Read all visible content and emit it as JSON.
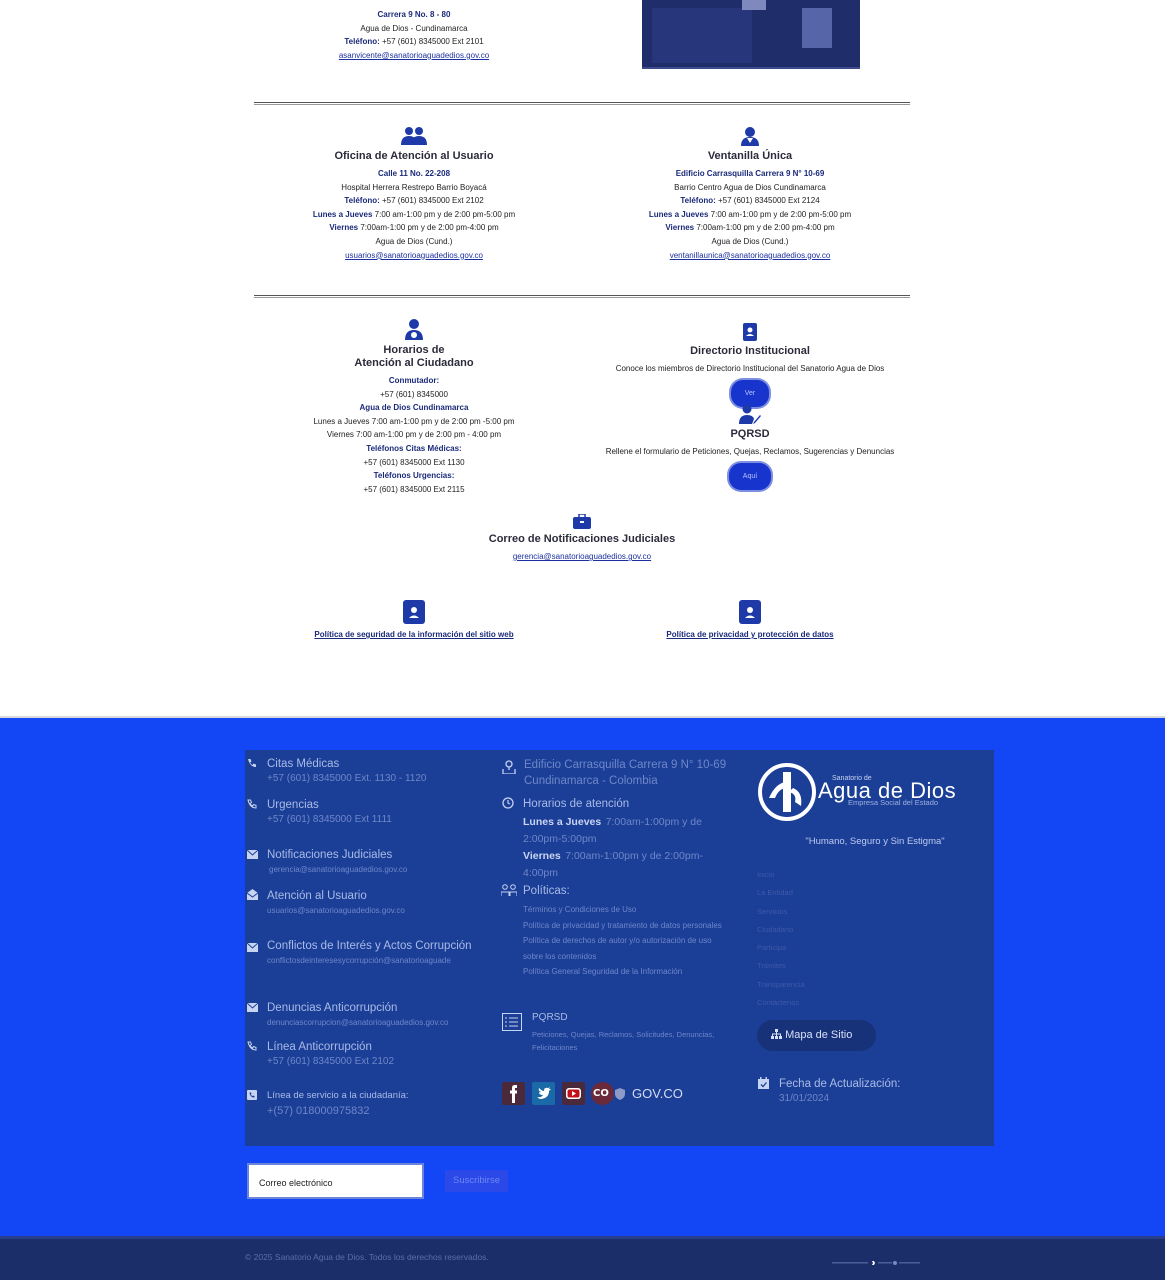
{
  "top": {
    "address_block": {
      "line1": "Carrera 9 No. 8 - 80",
      "line2": "Agua de Dios - Cundinamarca",
      "phone_label": "Teléfono:",
      "phone": "+57 (601) 8345000 Ext 2101",
      "email": "asanvicente@sanatorioaguadedios.gov.co"
    },
    "oficina": {
      "title": "Oficina de Atención al Usuario",
      "l1": "Calle 11 No. 22-208",
      "l2": "Hospital Herrera Restrepo Barrio Boyacá",
      "phone_label": "Teléfono:",
      "phone": "+57 (601) 8345000 Ext 2102",
      "h1_label": "Lunes a Jueves",
      "h1": "7:00 am-1:00 pm y de 2:00 pm-5:00 pm",
      "h2_label": "Viernes",
      "h2": "7:00am-1:00 pm y de 2:00 pm-4:00 pm",
      "city": "Agua de Dios (Cund.)",
      "email": "usuarios@sanatorioaguadedios.gov.co"
    },
    "ventanilla": {
      "title": "Ventanilla Única",
      "l1": "Edificio Carrasquilla Carrera 9 N° 10-69",
      "l2": "Barrio Centro Agua de Dios Cundinamarca",
      "phone_label": "Teléfono:",
      "phone": "+57 (601) 8345000 Ext 2124",
      "h1_label": "Lunes a Jueves",
      "h1": "7:00 am-1:00 pm y de 2:00 pm-5:00 pm",
      "h2_label": "Viernes",
      "h2": "7:00am-1:00 pm y de 2:00 pm-4:00 pm",
      "city": "Agua de Dios (Cund.)",
      "email": "ventanillaunica@sanatorioaguadedios.gov.co"
    },
    "horarios": {
      "title1": "Horarios de",
      "title2": "Atención al Ciudadano",
      "conm_label": "Conmutador:",
      "conm": "+57 (601) 8345000",
      "city": "Agua de Dios Cundinamarca",
      "h1": "Lunes a Jueves 7:00 am-1:00 pm y de 2:00 pm -5:00 pm",
      "h2": "Viernes 7:00 am-1:00 pm y de 2:00 pm - 4:00 pm",
      "citas_label": "Teléfonos Citas Médicas:",
      "citas": "+57 (601) 8345000 Ext 1130",
      "urg_label": "Teléfonos Urgencias:",
      "urg": "+57 (601) 8345000 Ext 2115"
    },
    "directorio": {
      "title": "Directorio Institucional",
      "desc": "Conoce los miembros de Directorio Institucional del Sanatorio Agua de Dios",
      "btn": "Ver"
    },
    "pqrsd": {
      "title": "PQRSD",
      "desc": "Rellene el formulario de Peticiones, Quejas, Reclamos, Sugerencias y Denuncias",
      "btn": "Aquí"
    },
    "notificaciones": {
      "title": "Correo de Notificaciones Judiciales",
      "email": "gerencia@sanatorioaguadedios.gov.co"
    },
    "politica1": "Política de seguridad de la información del sitio web",
    "politica2": "Política de privacidad y protección de datos"
  },
  "footer": {
    "col1": [
      {
        "title": "Citas Médicas",
        "value": "+57 (601) 8345000 Ext. 1130 - 1120"
      },
      {
        "title": "Urgencias",
        "value": "+57 (601) 8345000 Ext 1111"
      },
      {
        "title": "Notificaciones Judiciales",
        "value": "gerencia@sanatorioaguadedios.gov.co"
      },
      {
        "title": "Atención al Usuario",
        "value": "usuarios@sanatorioaguadedios.gov.co"
      },
      {
        "title": "Conflictos de Interés y Actos Corrupción",
        "value": "conflictosdeinteresesycorrupción@sanatorioaguade"
      },
      {
        "title": "Denuncias Anticorrupción",
        "value": "denunciascorrupcion@sanatorioaguadedios.gov.co"
      },
      {
        "title": "Línea Anticorrupción",
        "value": "+57 (601) 8345000 Ext 2102"
      },
      {
        "title": "Línea de servicio a la ciudadanía:",
        "value": "+(57) 018000975832"
      }
    ],
    "address": "Edificio Carrasquilla Carrera 9 N° 10-69 Cundinamarca - Colombia",
    "horarios_title": "Horarios de atención",
    "h1_label": "Lunes a Jueves",
    "h1": "7:00am-1:00pm y de 2:00pm-5:00pm",
    "h2_label": "Viernes",
    "h2": "7:00am-1:00pm y de 2:00pm-4:00pm",
    "politicas_title": "Políticas:",
    "politicas": [
      "Términos y Condiciones de Uso",
      "Política de privacidad y tratamiento de datos personales",
      "Política de derechos de autor y/o autorización de uso sobre los contenidos",
      "Política General Seguridad de la Información"
    ],
    "pqrsd_title": "PQRSD",
    "pqrsd_desc": "Peticiones, Quejas, Reclamos, Solicitudes, Denuncias, Felicitaciones",
    "govco": "GOV.CO",
    "logo_small": "Sanatorio de",
    "logo_big": "Agua de Dios",
    "logo_sub": "Empresa Social del Estado",
    "motto": "\"Humano, Seguro y Sin Estigma\"",
    "menu": [
      "Inicio",
      "La Entidad",
      "Servicios",
      "Ciudadano",
      "Participa",
      "Trámites",
      "Transparencia",
      "Contáctenos"
    ],
    "sitemap": "Mapa de Sitio",
    "fecha_title": "Fecha de Actualización:",
    "fecha": "31/01/2024",
    "subscribe_placeholder": "Correo electrónico",
    "subscribe_btn": "Suscribirse",
    "copyright": "© 2025 Sanatorio Agua de Dios. Todos los derechos reservados."
  },
  "colors": {
    "footer_bg": "#1346f5",
    "panel_bg": "#1b3e97",
    "accent": "#1e3aa8"
  }
}
